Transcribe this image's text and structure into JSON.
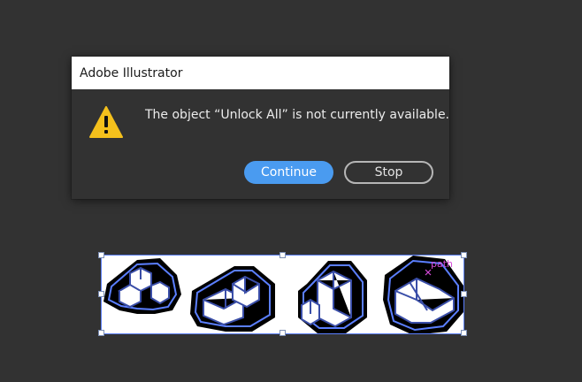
{
  "dialog": {
    "title": "Adobe Illustrator",
    "message": "The object “Unlock All” is not currently available.",
    "continue_label": "Continue",
    "stop_label": "Stop",
    "icon": "warning-icon"
  },
  "artboard": {
    "hint_label": "path",
    "icons": [
      "isometric-blocks-icon-1",
      "isometric-blocks-icon-2",
      "isometric-blocks-icon-3",
      "isometric-blocks-icon-4"
    ]
  },
  "colors": {
    "background": "#323232",
    "accent": "#4a9bf0",
    "warning": "#f4c01c",
    "selection": "#5b7fff",
    "hint": "#d54bd8"
  }
}
